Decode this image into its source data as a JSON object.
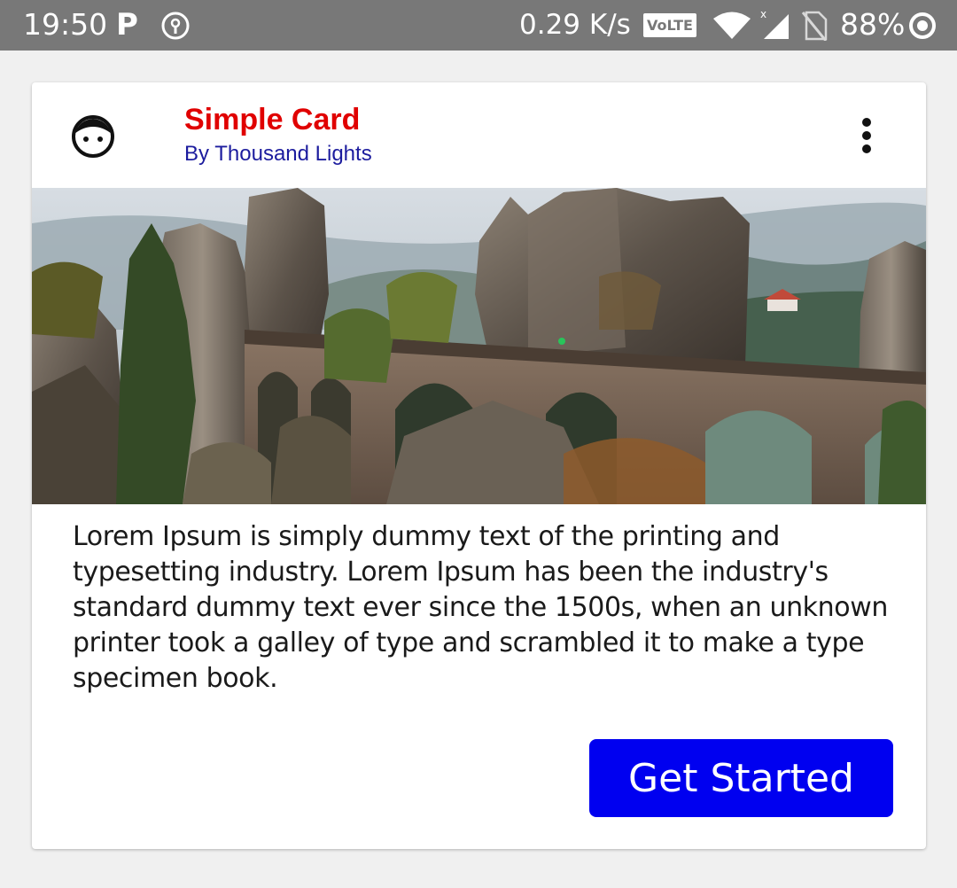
{
  "status_bar": {
    "time": "19:50",
    "p_indicator": "P",
    "net_speed": "0.29 K/s",
    "volte": "VoLTE",
    "battery": "88%"
  },
  "card": {
    "title": "Simple Card",
    "subtitle": "By Thousand Lights",
    "avatar_icon": "face-icon",
    "menu_icon": "more-vert-icon",
    "image": "rock-bridge-landscape",
    "body": "Lorem Ipsum is simply dummy text of the printing and typesetting industry. Lorem Ipsum has been the industry's standard dummy text ever since the 1500s, when an unknown printer took a galley of type and scrambled it to make a type specimen book.",
    "button_label": "Get Started"
  },
  "colors": {
    "title": "#e00000",
    "subtitle": "#1c1c9e",
    "button": "#0000f0",
    "status_bar": "#787878"
  }
}
